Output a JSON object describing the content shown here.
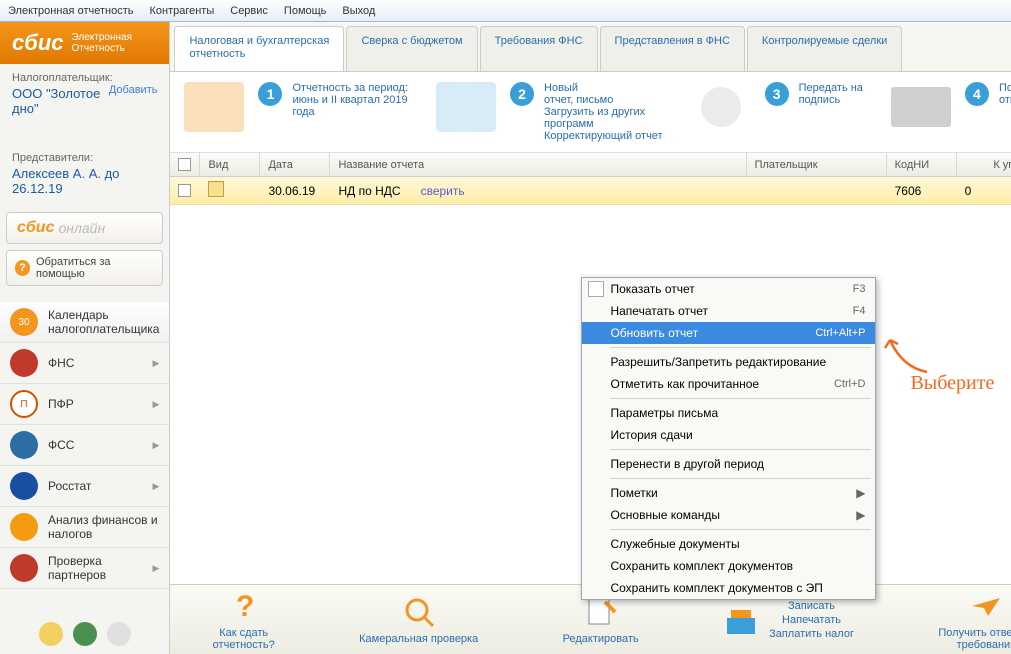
{
  "menubar": [
    "Электронная отчетность",
    "Контрагенты",
    "Сервис",
    "Помощь",
    "Выход"
  ],
  "logo": {
    "brand": "сбис",
    "sub1": "Электронная",
    "sub2": "Отчетность"
  },
  "taxpayer": {
    "label": "Налогоплательщик:",
    "add": "Добавить",
    "name": "ООО \"Золотое дно\""
  },
  "reps": {
    "label": "Представители:",
    "name": "Алексеев А. А. до 26.12.19"
  },
  "online_brand": "сбис",
  "online_word": "онлайн",
  "help_btn": "Обратиться за помощью",
  "nav": [
    {
      "label": "Календарь налогоплательщика",
      "color": "#f3961e"
    },
    {
      "label": "ФНС",
      "color": "#c0392b"
    },
    {
      "label": "ПФР",
      "color": "#d35400"
    },
    {
      "label": "ФСС",
      "color": "#2e6da4"
    },
    {
      "label": "Росстат",
      "color": "#1a4fa0"
    },
    {
      "label": "Анализ финансов и налогов",
      "color": "#f39c12"
    },
    {
      "label": "Проверка партнеров",
      "color": "#c0392b"
    }
  ],
  "tabs": [
    "Налоговая и бухгалтерская отчетность",
    "Сверка с бюджетом",
    "Требования ФНС",
    "Представления в ФНС",
    "Контролируемые сделки"
  ],
  "steps": [
    {
      "num": "1",
      "lines": [
        "Отчетность за период:",
        "июнь и II квартал 2019",
        "года"
      ]
    },
    {
      "num": "2",
      "lines": [
        "Новый",
        "отчет, письмо",
        "Загрузить из других",
        "программ",
        "Корректирующий отчет"
      ]
    },
    {
      "num": "3",
      "lines": [
        "Передать на",
        "подпись"
      ]
    },
    {
      "num": "4",
      "lines": [
        "Подписать и",
        "отправить"
      ]
    }
  ],
  "table": {
    "headers": {
      "vid": "Вид",
      "date": "Дата",
      "name": "Название отчета",
      "payer": "Плательщик",
      "kod": "КодНИ",
      "pay": "К уплате"
    },
    "row": {
      "date": "30.06.19",
      "name": "НД по НДС",
      "link": "сверить",
      "kod": "7606",
      "pay": "0"
    }
  },
  "ctx": [
    {
      "label": "Показать отчет",
      "shortcut": "F3",
      "icon": true
    },
    {
      "label": "Напечатать отчет",
      "shortcut": "F4"
    },
    {
      "label": "Обновить отчет",
      "shortcut": "Ctrl+Alt+P",
      "hl": true
    },
    {
      "sep": true
    },
    {
      "label": "Разрешить/Запретить редактирование"
    },
    {
      "label": "Отметить как прочитанное",
      "shortcut": "Ctrl+D"
    },
    {
      "sep": true
    },
    {
      "label": "Параметры письма"
    },
    {
      "label": "История сдачи"
    },
    {
      "sep": true
    },
    {
      "label": "Перенести в другой период"
    },
    {
      "sep": true
    },
    {
      "label": "Пометки",
      "sub": "▶"
    },
    {
      "label": "Основные команды",
      "sub": "▶"
    },
    {
      "sep": true
    },
    {
      "label": "Служебные документы"
    },
    {
      "label": "Сохранить комплект документов"
    },
    {
      "label": "Сохранить комплект документов с ЭП"
    }
  ],
  "annotation": "Выберите",
  "bottombar": {
    "help": {
      "line1": "Как сдать",
      "line2": "отчетность?"
    },
    "audit": "Камеральная проверка",
    "edit": "Редактировать",
    "multi": [
      "Записать",
      "Напечатать",
      "Заплатить налог"
    ],
    "send": {
      "line1": "Получить ответы и",
      "line2": "требования"
    }
  }
}
